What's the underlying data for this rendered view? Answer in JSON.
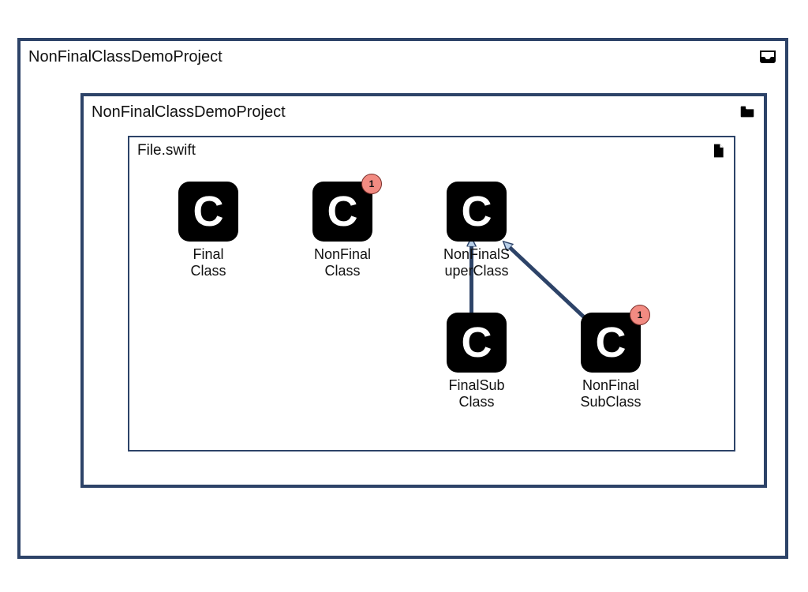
{
  "outer": {
    "title": "NonFinalClassDemoProject",
    "icon": "inbox-icon"
  },
  "mid": {
    "title": "NonFinalClassDemoProject",
    "icon": "folder-icon"
  },
  "inner": {
    "title": "File.swift",
    "icon": "file-icon"
  },
  "glyph": "C",
  "nodes": {
    "finalClass": {
      "label": "Final\nClass"
    },
    "nonFinalClass": {
      "label": "NonFinal\nClass",
      "badge": "1"
    },
    "nonFinalSuper": {
      "label": "NonFinalS\nuperClass"
    },
    "finalSubClass": {
      "label": "FinalSub\nClass"
    },
    "nonFinalSubClass": {
      "label": "NonFinal\nSubClass",
      "badge": "1"
    }
  },
  "relations": [
    {
      "from": "finalSubClass",
      "to": "nonFinalSuper"
    },
    {
      "from": "nonFinalSubClass",
      "to": "nonFinalSuper"
    }
  ]
}
